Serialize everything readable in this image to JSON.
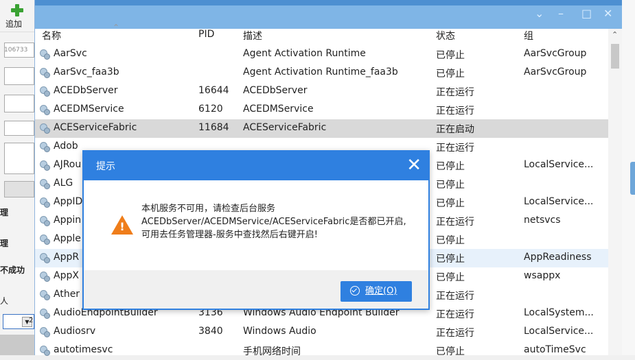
{
  "left_panel": {
    "add_label": "追加",
    "number_text": "106733",
    "labels": [
      "理",
      "理",
      "不成功",
      "人",
      "2"
    ]
  },
  "window": {
    "controls": [
      "⌄",
      "–",
      "□",
      "✕"
    ],
    "headers": {
      "name": "名称",
      "pid": "PID",
      "desc": "描述",
      "status": "状态",
      "group": "组"
    },
    "rows": [
      {
        "name": "AarSvc",
        "pid": "",
        "desc": "Agent Activation Runtime",
        "status": "已停止",
        "group": "AarSvcGroup"
      },
      {
        "name": "AarSvc_faa3b",
        "pid": "",
        "desc": "Agent Activation Runtime_faa3b",
        "status": "已停止",
        "group": "AarSvcGroup"
      },
      {
        "name": "ACEDbServer",
        "pid": "16644",
        "desc": "ACEDbServer",
        "status": "正在运行",
        "group": ""
      },
      {
        "name": "ACEDMService",
        "pid": "6120",
        "desc": "ACEDMService",
        "status": "正在运行",
        "group": ""
      },
      {
        "name": "ACEServiceFabric",
        "pid": "11684",
        "desc": "ACEServiceFabric",
        "status": "正在启动",
        "group": ""
      },
      {
        "name": "Adob",
        "pid": "",
        "desc": "",
        "status": "正在运行",
        "group": ""
      },
      {
        "name": "AJRou",
        "pid": "",
        "desc": "",
        "status": "已停止",
        "group": "LocalService..."
      },
      {
        "name": "ALG",
        "pid": "",
        "desc": "",
        "status": "已停止",
        "group": ""
      },
      {
        "name": "AppID",
        "pid": "",
        "desc": "",
        "status": "已停止",
        "group": "LocalService..."
      },
      {
        "name": "Appin",
        "pid": "",
        "desc": "",
        "status": "正在运行",
        "group": "netsvcs"
      },
      {
        "name": "Apple",
        "pid": "",
        "desc": "",
        "status": "已停止",
        "group": ""
      },
      {
        "name": "AppR",
        "pid": "",
        "desc": "",
        "status": "已停止",
        "group": "AppReadiness"
      },
      {
        "name": "AppX",
        "pid": "",
        "desc": "",
        "status": "已停止",
        "group": "wsappx"
      },
      {
        "name": "Ather",
        "pid": "",
        "desc": "",
        "status": "正在运行",
        "group": ""
      },
      {
        "name": "AudioEndpointBuilder",
        "pid": "3136",
        "desc": "Windows Audio Endpoint Builder",
        "status": "正在运行",
        "group": "LocalSystem..."
      },
      {
        "name": "Audiosrv",
        "pid": "3840",
        "desc": "Windows Audio",
        "status": "正在运行",
        "group": "LocalService..."
      },
      {
        "name": "autotimesvc",
        "pid": "",
        "desc": "手机网络时间",
        "status": "已停止",
        "group": "autoTimeSvc"
      }
    ]
  },
  "dialog": {
    "title": "提示",
    "message": "本机服务不可用，请检查后台服务ACEDbServer/ACEDMService/ACEServiceFabric是否都已开启,可用去任务管理器-服务中查找然后右键开启!",
    "ok_label": "确定(O)",
    "close_symbol": "✕"
  },
  "colors": {
    "titlebar": "#7fb5e6",
    "dialog_accent": "#2f80e0",
    "warning": "#ef7d1a",
    "selected_row": "#d9d9d9"
  }
}
